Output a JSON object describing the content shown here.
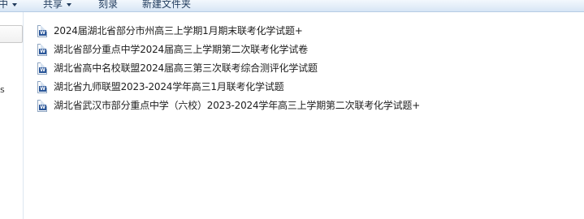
{
  "toolbar": {
    "items": [
      {
        "label": "中",
        "has_dropdown": true
      },
      {
        "label": "共享",
        "has_dropdown": true
      },
      {
        "label": "刻录",
        "has_dropdown": false
      },
      {
        "label": "新建文件夹",
        "has_dropdown": false
      }
    ]
  },
  "nav_pane": {
    "partial_label": "s"
  },
  "files": [
    {
      "name": "2024届湖北省部分市州高三上学期1月期末联考化学试题+",
      "icon": "word-doc-icon"
    },
    {
      "name": "湖北省部分重点中学2024届高三上学期第二次联考化学试卷",
      "icon": "word-doc-icon"
    },
    {
      "name": "湖北省高中名校联盟2024届高三第三次联考综合测评化学试题",
      "icon": "word-doc-icon"
    },
    {
      "name": "湖北省九师联盟2023-2024学年高三1月联考化学试题",
      "icon": "word-doc-icon"
    },
    {
      "name": "湖北省武汉市部分重点中学（六校）2023-2024学年高三上学期第二次联考化学试题+",
      "icon": "word-doc-icon"
    }
  ],
  "colors": {
    "toolbar_text": "#1e395b",
    "word_icon": "#2a5699"
  }
}
